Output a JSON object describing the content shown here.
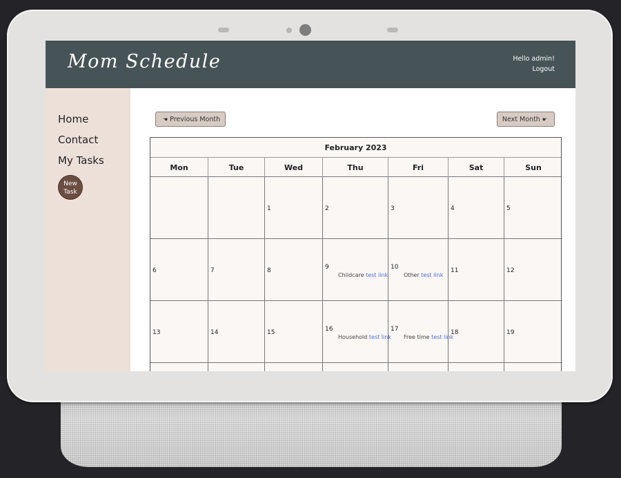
{
  "app": {
    "title": "Mom Schedule",
    "greeting": "Hello admin!",
    "logout": "Logout"
  },
  "sidebar": {
    "items": [
      {
        "label": "Home"
      },
      {
        "label": "Contact"
      },
      {
        "label": "My Tasks"
      }
    ],
    "new_task_line1": "New",
    "new_task_line2": "Task"
  },
  "nav": {
    "prev_label": "Previous Month",
    "next_label": "Next Month",
    "prev_icon": "hand-pointing-left-icon",
    "next_icon": "hand-pointing-right-icon"
  },
  "calendar": {
    "month_title": "February 2023",
    "weekdays": [
      "Mon",
      "Tue",
      "Wed",
      "Thu",
      "Fri",
      "Sat",
      "Sun"
    ],
    "weeks": [
      [
        {
          "day": "",
          "event": null
        },
        {
          "day": "",
          "event": null
        },
        {
          "day": "1",
          "event": null
        },
        {
          "day": "2",
          "event": null
        },
        {
          "day": "3",
          "event": null
        },
        {
          "day": "4",
          "event": null
        },
        {
          "day": "5",
          "event": null
        }
      ],
      [
        {
          "day": "6",
          "event": null
        },
        {
          "day": "7",
          "event": null
        },
        {
          "day": "8",
          "event": null
        },
        {
          "day": "9",
          "event": {
            "category": "Childcare",
            "link": "test link"
          }
        },
        {
          "day": "10",
          "event": {
            "category": "Other",
            "link": "test link"
          }
        },
        {
          "day": "11",
          "event": null
        },
        {
          "day": "12",
          "event": null
        }
      ],
      [
        {
          "day": "13",
          "event": null
        },
        {
          "day": "14",
          "event": null
        },
        {
          "day": "15",
          "event": null
        },
        {
          "day": "16",
          "event": {
            "category": "Household",
            "link": "test link"
          }
        },
        {
          "day": "17",
          "event": {
            "category": "Free time",
            "link": "test link"
          }
        },
        {
          "day": "18",
          "event": null
        },
        {
          "day": "19",
          "event": null
        }
      ],
      [
        {
          "day": "",
          "event": null
        },
        {
          "day": "",
          "event": null
        },
        {
          "day": "",
          "event": null
        },
        {
          "day": "",
          "event": null
        },
        {
          "day": "",
          "event": null
        },
        {
          "day": "",
          "event": null
        },
        {
          "day": "",
          "event": null
        }
      ]
    ]
  },
  "colors": {
    "header": "#465357",
    "sidebar": "#ede0d9",
    "new_task_button": "#6b4e42",
    "calendar_bg": "#faf7f5",
    "link": "#4e6bd8"
  }
}
